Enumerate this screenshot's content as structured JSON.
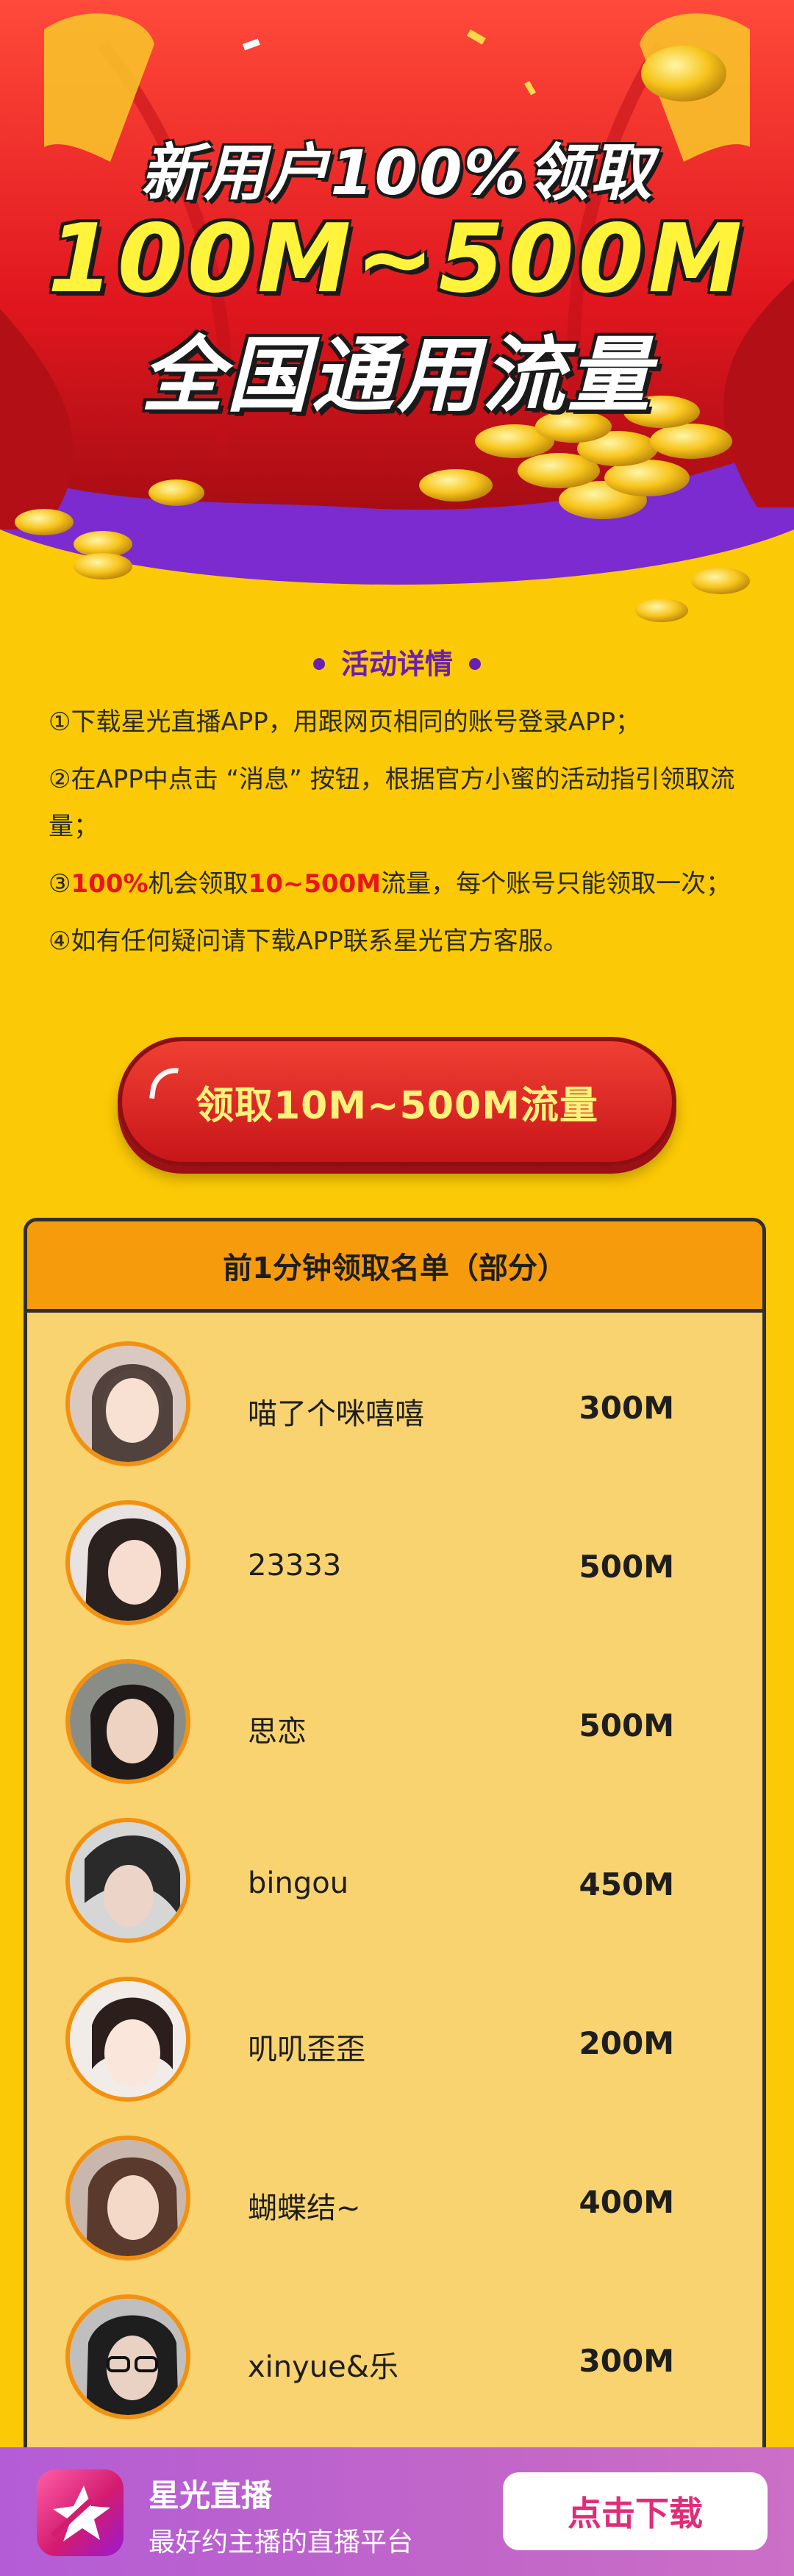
{
  "hero": {
    "line1": "新用户100%领取",
    "line2": "100M~500M",
    "line3": "全国通用流量"
  },
  "details": {
    "title": "活动详情",
    "rule1": "①下载星光直播APP，用跟网页相同的账号登录APP；",
    "rule2": "②在APP中点击 “消息” 按钮，根据官方小蜜的活动指引领取流量；",
    "rule3": {
      "prefix": "③",
      "hl1": "100%",
      "mid": "机会领取",
      "hl2": "10~500M",
      "suffix": "流量，每个账号只能领取一次；"
    },
    "rule4": "④如有任何疑问请下载APP联系星光官方客服。"
  },
  "claim": {
    "label": "领取10M~500M流量"
  },
  "winners": {
    "title": "前1分钟领取名单（部分）",
    "rows": [
      {
        "name": "喵了个咪嘻嘻",
        "amount": "300M"
      },
      {
        "name": "23333",
        "amount": "500M"
      },
      {
        "name": "思恋",
        "amount": "500M"
      },
      {
        "name": "bingou",
        "amount": "450M"
      },
      {
        "name": "叽叽歪歪",
        "amount": "200M"
      },
      {
        "name": "蝴蝶结~",
        "amount": "400M"
      },
      {
        "name": "xinyue&乐",
        "amount": "300M"
      }
    ]
  },
  "download_bar": {
    "app_name": "星光直播",
    "slogan": "最好约主播的直播平台",
    "button_label": "点击下载"
  },
  "colors": {
    "accent_red": "#e8151b",
    "title_purple": "#6a1fb0",
    "background_yellow": "#fbc905",
    "button_pink": "#e22c77"
  }
}
